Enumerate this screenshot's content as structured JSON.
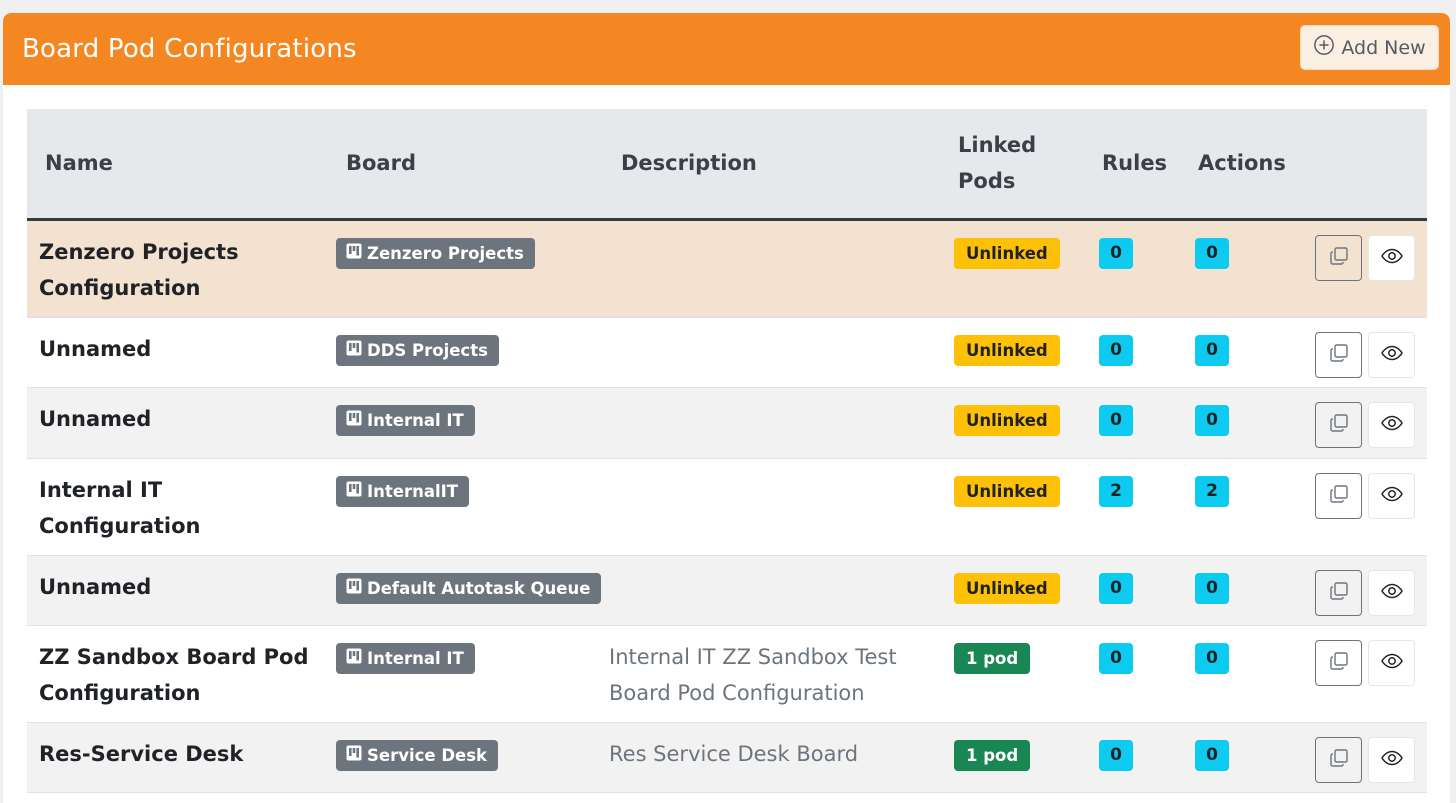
{
  "header": {
    "title": "Board Pod Configurations",
    "add_label": "Add New"
  },
  "table": {
    "columns": [
      "Name",
      "Board",
      "Description",
      "Linked Pods",
      "Rules",
      "Actions"
    ],
    "rows": [
      {
        "name": "Zenzero Projects Configuration",
        "board": "Zenzero Projects",
        "description": "",
        "linked": "Unlinked",
        "rules": "0",
        "actions": "0"
      },
      {
        "name": "Unnamed",
        "board": "DDS Projects",
        "description": "",
        "linked": "Unlinked",
        "rules": "0",
        "actions": "0"
      },
      {
        "name": "Unnamed",
        "board": "Internal IT",
        "description": "",
        "linked": "Unlinked",
        "rules": "0",
        "actions": "0"
      },
      {
        "name": "Internal IT Configuration",
        "board": "InternalIT",
        "description": "",
        "linked": "Unlinked",
        "rules": "2",
        "actions": "2"
      },
      {
        "name": "Unnamed",
        "board": "Default Autotask Queue",
        "description": "",
        "linked": "Unlinked",
        "rules": "0",
        "actions": "0"
      },
      {
        "name": "ZZ Sandbox Board Pod Configuration",
        "board": "Internal IT",
        "description": "Internal IT ZZ Sandbox Test Board Pod Configuration",
        "linked": "1 pod",
        "rules": "0",
        "actions": "0"
      },
      {
        "name": "Res-Service Desk",
        "board": "Service Desk",
        "description": "Res Service Desk Board",
        "linked": "1 pod",
        "rules": "0",
        "actions": "0"
      }
    ]
  },
  "icons": {
    "add": "plus-circle-icon",
    "board": "kanban-icon",
    "duplicate": "copy-icon",
    "view": "eye-icon"
  },
  "colors": {
    "header_bg": "#f58723",
    "unlinked": "#ffc107",
    "linked": "#198754",
    "count": "#0dcaf0",
    "board_badge": "#6c757d",
    "selected_row": "#f3e2d0"
  }
}
